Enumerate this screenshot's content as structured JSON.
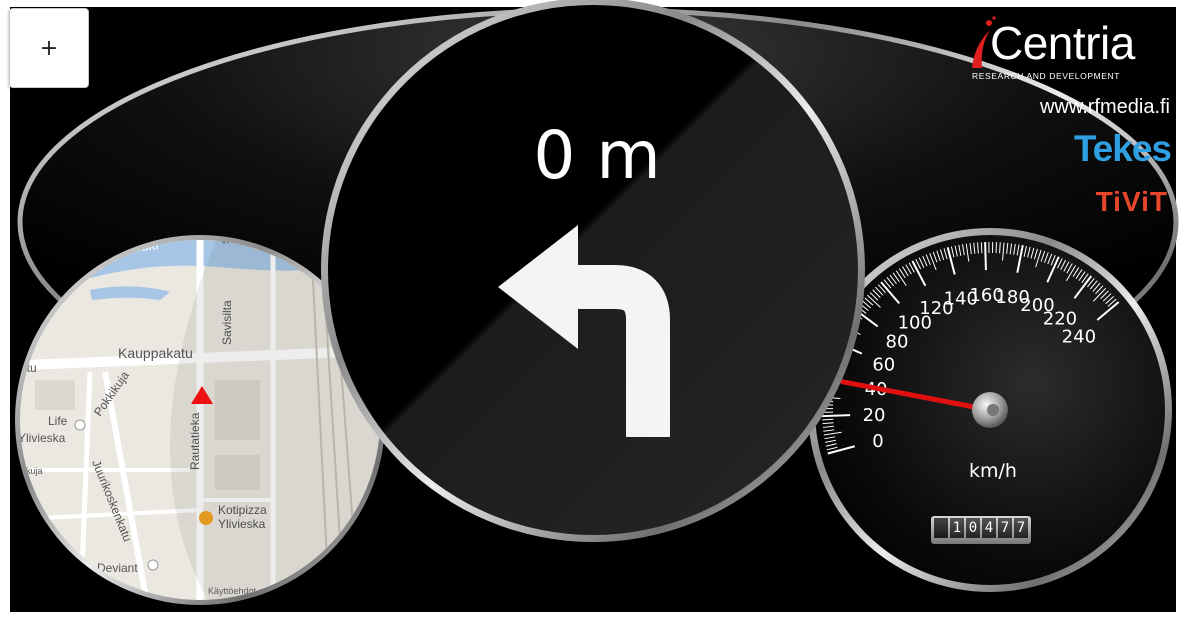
{
  "zoom_button": {
    "label": "+"
  },
  "navigation": {
    "distance_text": "0 m",
    "maneuver": "turn-left"
  },
  "map": {
    "labels": [
      {
        "text": "Vähäjoki / Särinkoski",
        "display": "rinkoski"
      },
      {
        "text": "Kauppakatu",
        "display": "Kauppakatu"
      },
      {
        "text": "Savisilta",
        "display": "Savisilta"
      },
      {
        "text": "Pokkikuja",
        "display": "Pokkikuja"
      },
      {
        "text": "Life Ylivieska",
        "display": "Life"
      },
      {
        "text": "Ylivieska",
        "display": "Ylivieska"
      },
      {
        "text": "Rautatiekatu",
        "display": "Rautatieka"
      },
      {
        "text": "Juurikoskenkatu",
        "display": "Juurikoskenkatu"
      },
      {
        "text": "Kotipizza",
        "display": "Kotipizza"
      },
      {
        "text": "Ylivieska",
        "display": "Ylivieska"
      },
      {
        "text": "Deviant",
        "display": "Deviant"
      },
      {
        "text": "Käyttöehdot",
        "display": "Käyttöehdot"
      },
      {
        "text": "utu",
        "display": "utu"
      },
      {
        "text": "Ka",
        "display": "Ka"
      },
      {
        "text": "Sa",
        "display": "Sa"
      },
      {
        "text": "kuja",
        "display": "kuja"
      }
    ],
    "position_marker_color": "#ee1111"
  },
  "speedometer": {
    "current_speed": 40,
    "unit": "km/h",
    "max_speed": 240,
    "tick_labels": [
      "0",
      "20",
      "40",
      "60",
      "80",
      "100",
      "120",
      "140",
      "160",
      "180",
      "200",
      "220",
      "240"
    ],
    "needle_color": "#e01010",
    "odometer_digits": [
      "",
      "1",
      "0",
      "4",
      "7",
      "7"
    ]
  },
  "branding": {
    "centria_title": "Centria",
    "centria_subtitle": "RESEARCH AND DEVELOPMENT",
    "centria_accent": "#e02020",
    "website": "www.rfmedia.fi",
    "tekes": "Tekes",
    "tekes_color": "#2e9fe0",
    "tivit": "TiViT",
    "tivit_color": "#e8462a"
  }
}
